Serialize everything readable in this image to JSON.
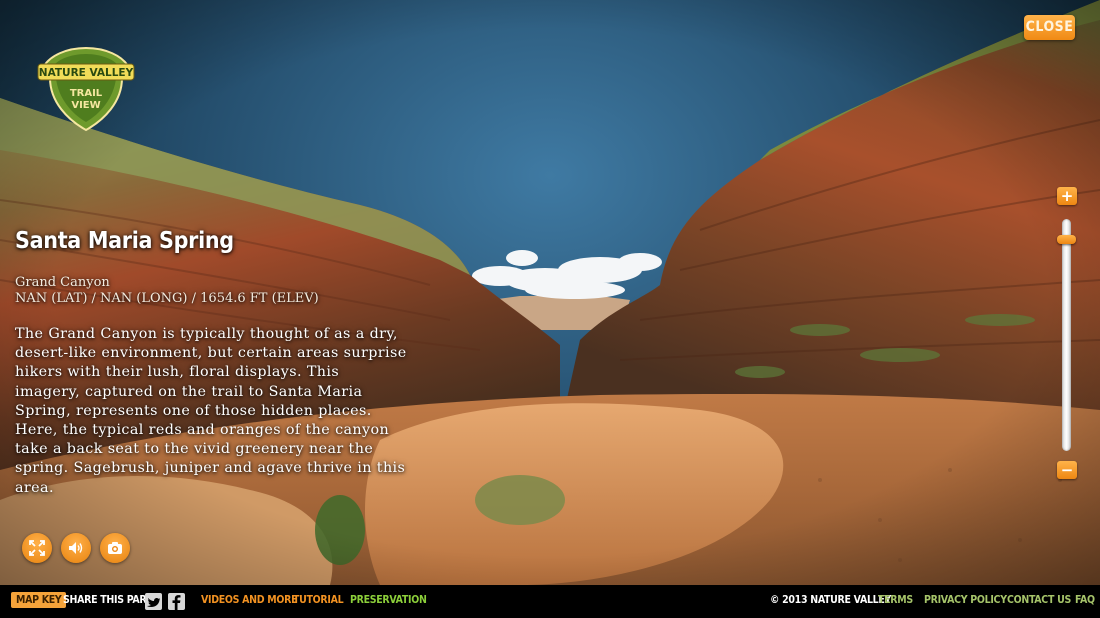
{
  "logo": {
    "brand": "NATURE VALLEY",
    "line1": "TRAIL",
    "line2": "VIEW"
  },
  "close_label": "CLOSE",
  "place": {
    "title": "Santa Maria Spring",
    "region": "Grand Canyon",
    "coords": "NAN (LAT) / NAN (LONG) / 1654.6 FT (ELEV)",
    "description": "The Grand Canyon is typically thought of as a dry, desert-like environment, but certain areas surprise hikers with their lush, floral displays. This imagery, captured on the trail to Santa Maria Spring, represents one of those hidden places. Here, the typical reds and oranges of the canyon take a back seat to the vivid greenery near the spring. Sagebrush, juniper and agave thrive in this area."
  },
  "controls": {
    "fullscreen_icon": "fullscreen-icon",
    "sound_icon": "speaker-icon",
    "camera_icon": "camera-icon"
  },
  "zoom": {
    "plus": "+",
    "minus": "−",
    "level": 0.93
  },
  "footer": {
    "map_key": "MAP KEY",
    "share": "SHARE THIS PARK",
    "videos": "VIDEOS AND MORE",
    "tutorial": "TUTORIAL",
    "preservation": "PRESERVATION",
    "copyright": "© 2013 NATURE VALLEY",
    "terms": "TERMS",
    "privacy": "PRIVACY POLICY",
    "contact": "CONTACT US",
    "faq": "FAQ"
  },
  "colors": {
    "accent": "#f29222",
    "green_link": "#8ccf3a",
    "olive_link": "#a6c46a"
  }
}
